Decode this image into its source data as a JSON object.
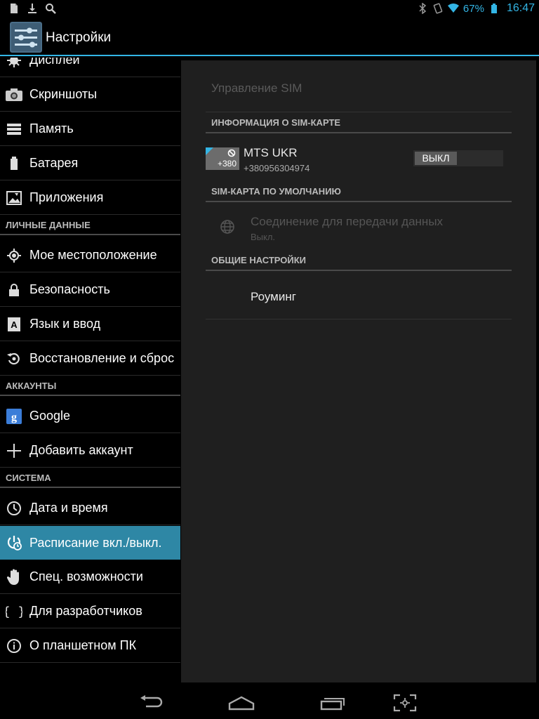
{
  "status_bar": {
    "battery_percent": "67%",
    "time": "16:47",
    "left_icons": [
      "document-icon",
      "download-icon",
      "search-icon"
    ],
    "right_icons": [
      "bluetooth-icon",
      "vibrate-icon",
      "wifi-icon",
      "battery-icon"
    ],
    "accent": "#33b5e5"
  },
  "action_bar": {
    "title": "Настройки"
  },
  "sidebar": {
    "items": [
      {
        "label": "Дисплей",
        "icon": "display-icon"
      },
      {
        "label": "Скриншоты",
        "icon": "camera-icon"
      },
      {
        "label": "Память",
        "icon": "storage-icon"
      },
      {
        "label": "Батарея",
        "icon": "battery-icon"
      },
      {
        "label": "Приложения",
        "icon": "apps-icon"
      }
    ],
    "section_personal": "ЛИЧНЫЕ ДАННЫЕ",
    "personal_items": [
      {
        "label": "Мое местоположение",
        "icon": "location-icon"
      },
      {
        "label": "Безопасность",
        "icon": "lock-icon"
      },
      {
        "label": "Язык и ввод",
        "icon": "keyboard-icon"
      },
      {
        "label": "Восстановление и сброс",
        "icon": "backup-icon"
      }
    ],
    "section_accounts": "АККАУНТЫ",
    "account_items": [
      {
        "label": "Google",
        "icon": "google-icon"
      },
      {
        "label": "Добавить аккаунт",
        "icon": "plus-icon"
      }
    ],
    "section_system": "СИСТЕМА",
    "system_items": [
      {
        "label": "Дата и время",
        "icon": "clock-icon"
      },
      {
        "label": "Расписание вкл./выкл.",
        "icon": "power-schedule-icon",
        "selected": true
      },
      {
        "label": "Спец. возможности",
        "icon": "hand-icon"
      },
      {
        "label": "Для разработчиков",
        "icon": "braces-icon"
      },
      {
        "label": "О планшетном ПК",
        "icon": "info-icon"
      }
    ]
  },
  "detail": {
    "title": "Управление SIM",
    "sim_info_header": "ИНФОРМАЦИЯ О SIM-КАРТЕ",
    "sim": {
      "badge": "+380",
      "name": "MTS UKR",
      "number": "+380956304974",
      "toggle_label": "ВЫКЛ"
    },
    "default_sim_header": "SIM-КАРТА ПО УМОЛЧАНИЮ",
    "data_connection": {
      "title": "Соединение для передачи данных",
      "summary": "Выкл."
    },
    "general_header": "ОБЩИЕ НАСТРОЙКИ",
    "roaming_label": "Роуминг"
  }
}
